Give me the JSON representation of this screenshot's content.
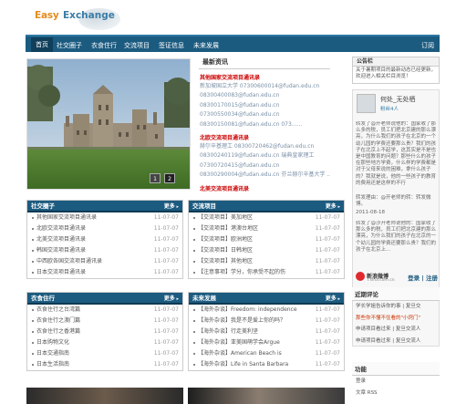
{
  "logo": {
    "part1": "Easy",
    "part2": "Exchange"
  },
  "nav": {
    "items": [
      "首页",
      "社交圈子",
      "衣食住行",
      "交流项目",
      "签证信息",
      "未来发展"
    ],
    "right": "订阅"
  },
  "slideshow": {
    "pages": [
      "1",
      "2"
    ]
  },
  "news": {
    "title": "最新资讯",
    "groups": [
      {
        "heading": "其他国家交流项目通讯录",
        "lines": [
          "新加坡国立大学 07300600014@fudan.edu.cn",
          "08300400083@fudan.edu.cn",
          "08300170015@fudan.edu.cn",
          "07300550034@fudan.edu.cn",
          "08300150081@fudan.edu.cn 073......"
        ]
      },
      {
        "heading": "北欧交流项目通讯录",
        "lines": [
          "赫尔辛基理工 08300720462@fudan.edu.cn",
          "08300240119@fudan.edu.cn 瑞典皇家理工",
          "07300720415@fudan.edu.cn",
          "08300290004@fudan.edu.cn 芬兰赫尔辛基大学 ......"
        ]
      },
      {
        "heading": "北美交流项目通讯录",
        "lines": []
      }
    ]
  },
  "notice": {
    "title": "公告栏",
    "text": "关于暑期项目的最新动态已经更新，欢迎进入相关栏目浏览！"
  },
  "profile": {
    "name": "何处_无处栖",
    "fans": "粉丝4人",
    "posts": [
      {
        "text": "转发了@开老师说他的：国家收了那么多的税，员工们把北京建的那么漂亮，为什么我们的孩子在北京的一个幼儿园的学费还要那么贵？我们的孩子在北京上不起学，这其实是不是也是中国教育的问题？那些什么的孩子在那些地方学费，什么样的学费都是对于父母来说的困难，拿什么孩子的？我就是说，他的一些孩子的教育的费用还是这样的不行",
        "date": ""
      },
      {
        "text": "转发理由：@开老师的转：转发微博。",
        "date": "2011-08-18"
      },
      {
        "text": "转发了@沙开老师说他的：国家收了那么多的税，员工们把北京建的那么漂亮，为什么我们的孩子在北京的一个幼儿园的学费还要那么贵？我们的孩子在北京上...",
        "date": ""
      }
    ],
    "weibo": {
      "name": "新浪微博",
      "sub": "T.sina.com.cn",
      "links": "登录 | 注册"
    }
  },
  "comments": {
    "title": "近期评论",
    "items": [
      {
        "text": "学长学姐告诉你的事 | 复旦交",
        "highlight": false
      },
      {
        "text": "那些你不懂不住看的\"小窍门\"",
        "highlight": true
      },
      {
        "text": "申请项目看过来 | 复旦交流人",
        "highlight": false
      },
      {
        "text": "申请项目看过来 | 复旦交流人",
        "highlight": false
      }
    ]
  },
  "functions": {
    "title": "功能",
    "items": [
      "登录",
      "文章 RSS"
    ]
  },
  "boxes": [
    {
      "title": "社交圈子",
      "more": "更多",
      "rows": [
        {
          "text": "其他国家交流项目通讯录",
          "date": "11-07-07"
        },
        {
          "text": "北欧交流项目通讯录",
          "date": "11-07-07"
        },
        {
          "text": "北美交流项目通讯录",
          "date": "11-07-07"
        },
        {
          "text": "韩国交流项目通讯录",
          "date": "11-07-07"
        },
        {
          "text": "中西欧各国交流项目通讯录",
          "date": "11-07-07"
        },
        {
          "text": "日本交流项目通讯录",
          "date": "11-07-07"
        }
      ]
    },
    {
      "title": "交流项目",
      "more": "更多",
      "rows": [
        {
          "text": "【交流项目】美加地区",
          "date": "11-07-07"
        },
        {
          "text": "【交流项目】港澳台地区",
          "date": "11-07-07"
        },
        {
          "text": "【交流项目】欧洲地区",
          "date": "11-07-07"
        },
        {
          "text": "【交流项目】日韩地区",
          "date": "11-07-07"
        },
        {
          "text": "【交流项目】其他地区",
          "date": "11-07-07"
        },
        {
          "text": "【注意事项】学分，你承受不起的伤",
          "date": "11-07-07"
        }
      ]
    },
    {
      "title": "衣食住行",
      "more": "更多",
      "rows": [
        {
          "text": "衣食住行之台湾篇",
          "date": "11-07-07"
        },
        {
          "text": "衣食住行之澳门篇",
          "date": "11-07-07"
        },
        {
          "text": "衣食住行之香港篇",
          "date": "11-07-07"
        },
        {
          "text": "日本购物文化",
          "date": "11-07-07"
        },
        {
          "text": "日本交通指南",
          "date": "11-07-07"
        },
        {
          "text": "日本生活指南",
          "date": "11-07-07"
        }
      ]
    },
    {
      "title": "未来发展",
      "more": "更多",
      "rows": [
        {
          "text": "【海外杂谈】Freedom: independence",
          "date": "11-07-07"
        },
        {
          "text": "【海外杂谈】我是不是爱上你的吗？",
          "date": "11-07-07"
        },
        {
          "text": "【海外杂谈】行走美利坚",
          "date": "11-07-07"
        },
        {
          "text": "【海外杂谈】亚美国萌学会Argue",
          "date": "11-07-07"
        },
        {
          "text": "【海外杂谈】American Beach is",
          "date": "11-07-07"
        },
        {
          "text": "【海外杂谈】Life in Santa Barbara",
          "date": "11-07-07"
        }
      ]
    }
  ],
  "colors": {
    "nav": "#1c5b80",
    "accent": "#cc0000",
    "logo_orange": "#e38d1e",
    "logo_blue": "#3a7da6"
  }
}
